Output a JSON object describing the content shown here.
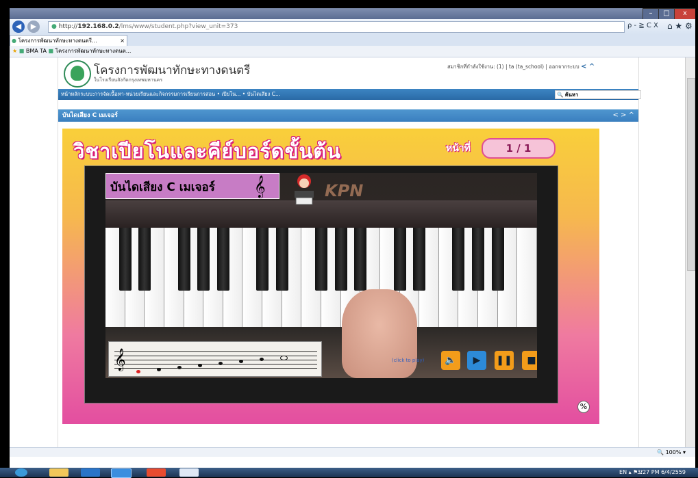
{
  "browser": {
    "url_prefix": "http://",
    "url_host": "192.168.0.2",
    "url_path": "/lms/www/student.php?view_unit=373",
    "search_controls": "ρ - ≧ C X",
    "tab_title": "โครงการพัฒนาทักษะทางดนตรี...",
    "favorites": [
      "BMA TA",
      "โครงการพัฒนาทักษะทางดนต..."
    ],
    "zoom": "100%"
  },
  "site": {
    "title": "โครงการพัฒนาทักษะทางดนตรี",
    "subtitle": "ในโรงเรียนสังกัดกรุงเทพมหานคร",
    "user_line": "สมาชิกที่กำลังใช้งาน: (1) | ta (ta_school) | ออกจากระบบ"
  },
  "nav": {
    "breadcrumb": "หน้าหลักระบบ:การจัดเนื้อหา-หน่วยเรียนและกิจกรรมการเรียนการสอน • เปียโน... • บันไดเสียง C...",
    "search_label": "ค้นหา"
  },
  "section": {
    "title": "บันไดเสียง C เมเจอร์",
    "nav_symbols": "< > ^"
  },
  "lesson": {
    "title": "วิชาเปียโนและคีย์บอร์ดขั้นต้น",
    "page_label": "หน้าที่",
    "page_value": "1 / 1",
    "video_title": "บันไดเสียง C เมเจอร์",
    "clef": "𝄞",
    "brand": "KPN",
    "controls_label": "(click to play)",
    "resize_symbol": "%"
  },
  "taskbar": {
    "lang": "EN",
    "time": "3:27 PM",
    "date": "6/4/2559"
  }
}
